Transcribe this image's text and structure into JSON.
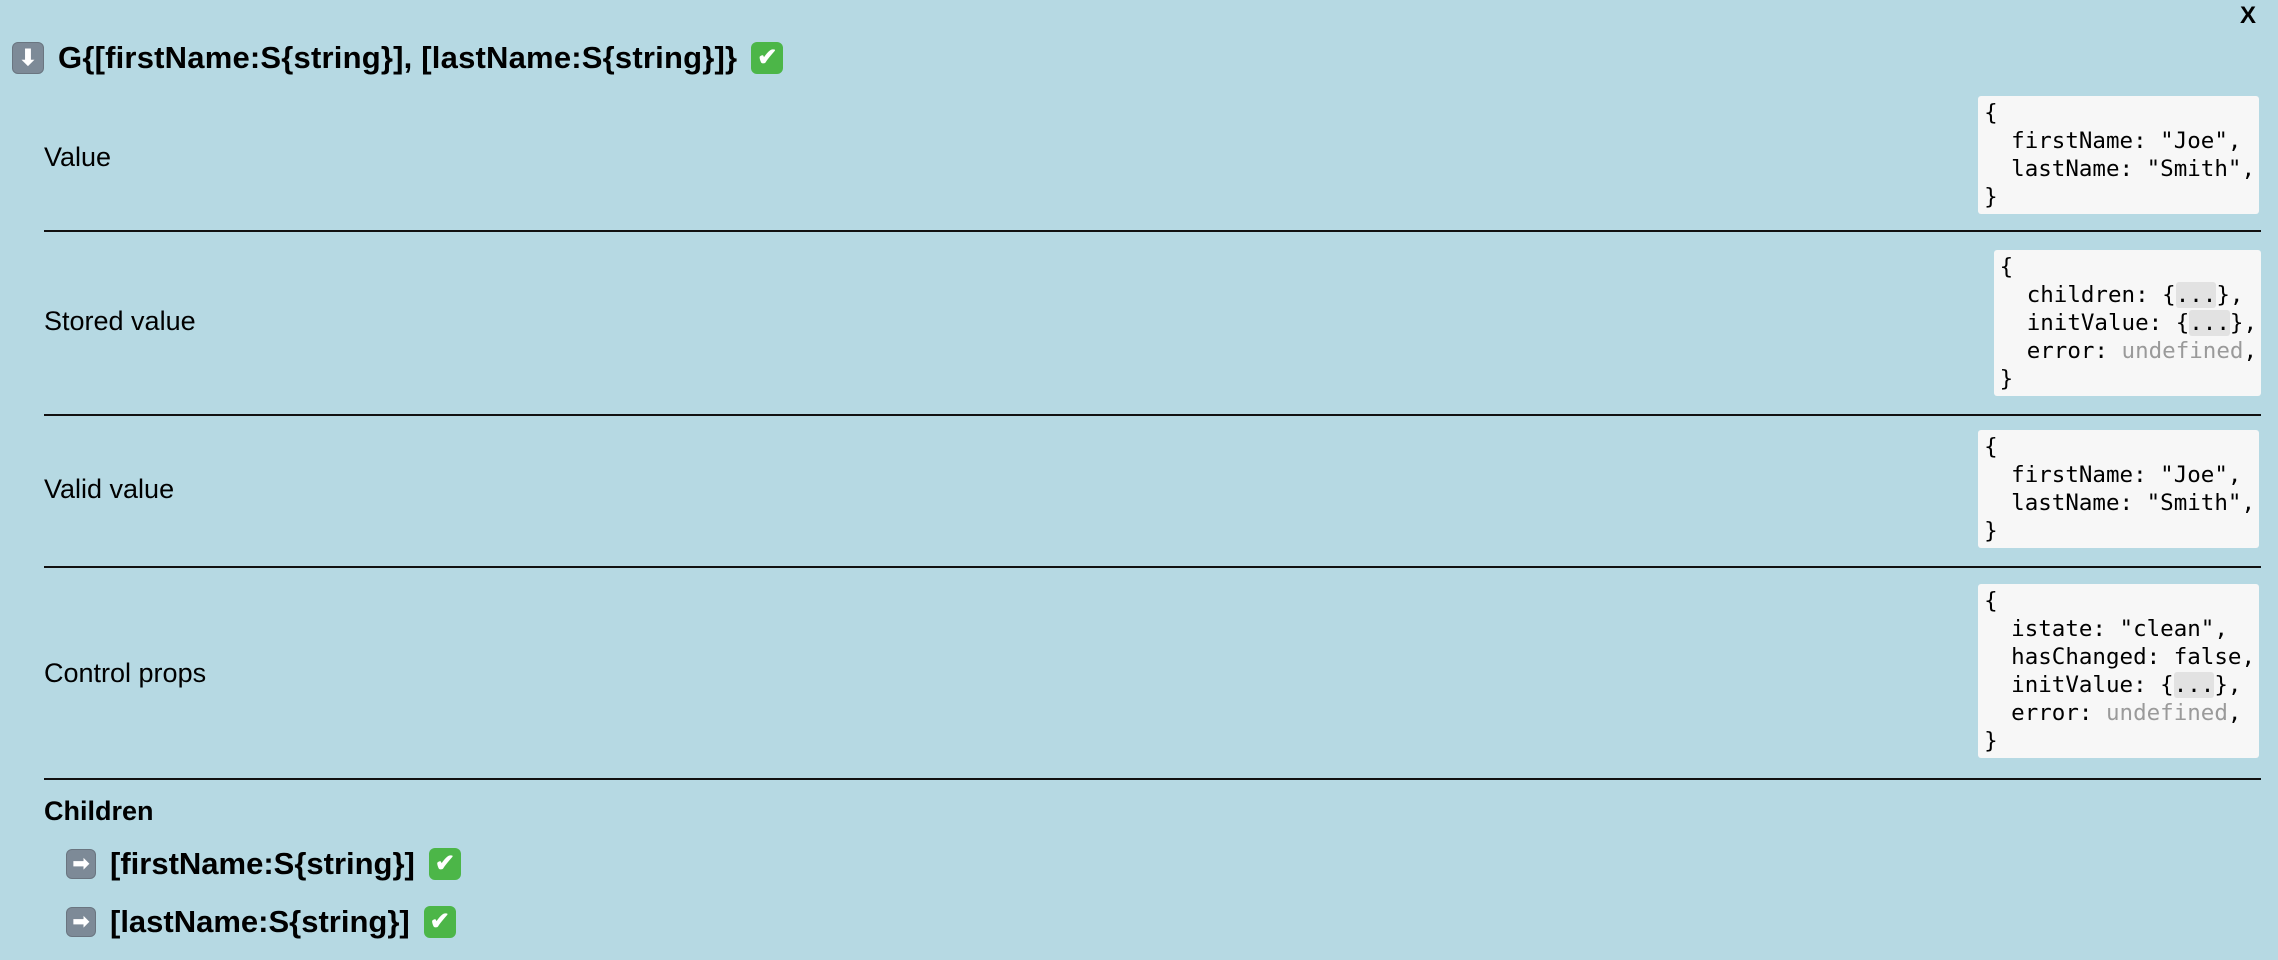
{
  "close_label": "X",
  "header": {
    "toggle_icon": "down-arrow-icon",
    "toggle_glyph": "⬇",
    "title": "G{[firstName:S{string}], [lastName:S{string}]}",
    "status_icon": "check-mark-icon",
    "status_glyph": "✔"
  },
  "sections": {
    "value": {
      "label": "Value",
      "code": {
        "open": "{",
        "line1_key": "  firstName: ",
        "line1_val": "\"Joe\",",
        "line2_key": "  lastName: ",
        "line2_val": "\"Smith\",",
        "close": "}"
      }
    },
    "stored_value": {
      "label": "Stored value",
      "code": {
        "open": "{",
        "line1_key": "  children: {",
        "line1_ellipsis": "...",
        "line1_end": "},",
        "line2_key": "  initValue: {",
        "line2_ellipsis": "...",
        "line2_end": "},",
        "line3_key": "  error: ",
        "line3_val": "undefined",
        "line3_end": ",",
        "close": "}"
      }
    },
    "valid_value": {
      "label": "Valid value",
      "code": {
        "open": "{",
        "line1_key": "  firstName: ",
        "line1_val": "\"Joe\",",
        "line2_key": "  lastName: ",
        "line2_val": "\"Smith\",",
        "close": "}"
      }
    },
    "control_props": {
      "label": "Control props",
      "code": {
        "open": "{",
        "line1_key": "  istate: ",
        "line1_val": "\"clean\",",
        "line2_key": "  hasChanged: ",
        "line2_val": "false,",
        "line3_key": "  initValue: {",
        "line3_ellipsis": "...",
        "line3_end": "},",
        "line4_key": "  error: ",
        "line4_val": "undefined",
        "line4_end": ",",
        "close": "}"
      }
    }
  },
  "children": {
    "label": "Children",
    "items": [
      {
        "expand_icon": "right-arrow-icon",
        "expand_glyph": "➡",
        "title": "[firstName:S{string}]",
        "status_icon": "check-mark-icon",
        "status_glyph": "✔"
      },
      {
        "expand_icon": "right-arrow-icon",
        "expand_glyph": "➡",
        "title": "[lastName:S{string}]",
        "status_icon": "check-mark-icon",
        "status_glyph": "✔"
      }
    ]
  },
  "colors": {
    "background": "#b6d9e3",
    "code_background": "#f7f7f7",
    "check_green": "#4cb648",
    "arrow_gray": "#7d8a97",
    "muted_text": "#9a9a9a"
  }
}
